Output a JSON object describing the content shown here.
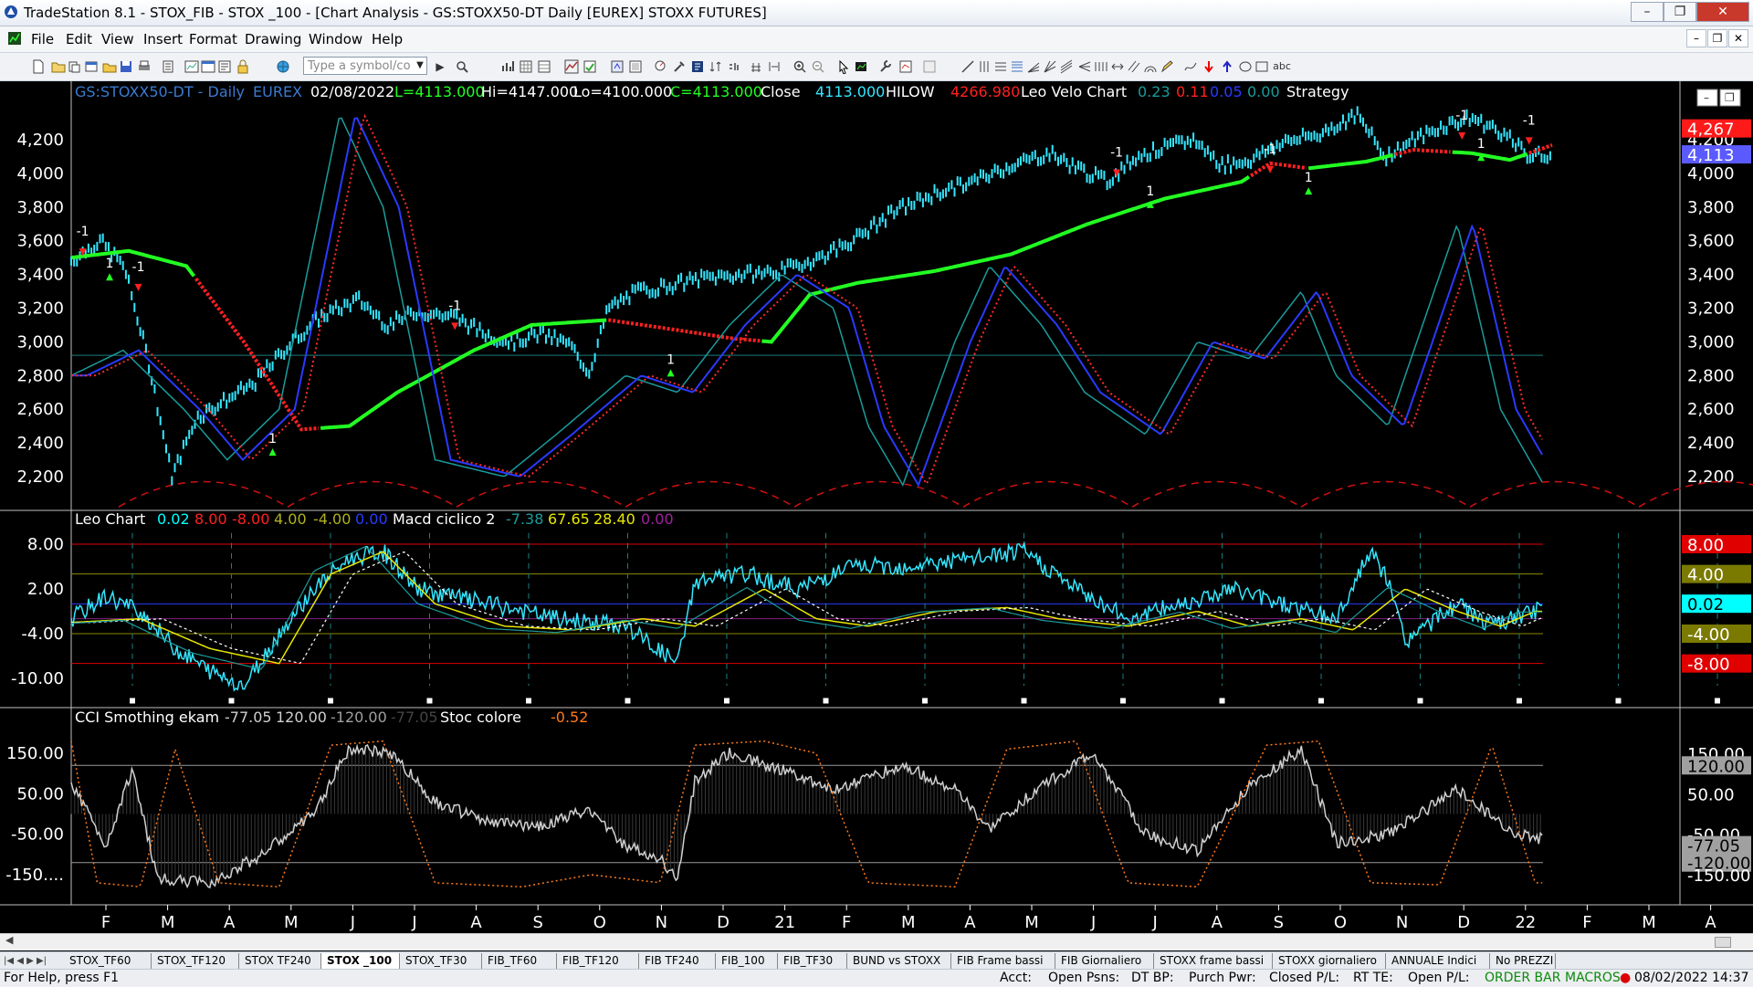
{
  "window": {
    "title": "TradeStation 8.1 - STOX_FIB - STOX _100 - [Chart Analysis - GS:STOXX50-DT  Daily  [EUREX] STOXX FUTURES]",
    "controls": [
      "–",
      "❐",
      "✕"
    ]
  },
  "menu": {
    "items": [
      "File",
      "Edit",
      "View",
      "Insert",
      "Format",
      "Drawing",
      "Window",
      "Help"
    ],
    "mdi_controls": [
      "–",
      "❐",
      "✕"
    ]
  },
  "toolbar": {
    "symbol_placeholder": "Type a symbol/co",
    "text_tool": "abc"
  },
  "price_panel": {
    "header": {
      "symbol": "GS:STOXX50-DT - Daily",
      "exchange": "EUREX",
      "date": "02/08/2022",
      "last": "L=4113.000",
      "high": "Hi=4147.000",
      "low": "Lo=4100.000",
      "close_eq": "C=4113.000",
      "close_label": "Close",
      "close_value": "4113.000",
      "hilow_label": "HILOW",
      "hilow_value": "4266.980",
      "study_name": "Leo Velo Chart",
      "v1": "0.23",
      "v2": "0.11",
      "v3": "0.05",
      "v4": "0.00",
      "strategy": "Strategy"
    },
    "y_labels": [
      "4,200",
      "4,000",
      "3,800",
      "3,600",
      "3,400",
      "3,200",
      "3,000",
      "2,800",
      "2,600",
      "2,400",
      "2,200"
    ],
    "y_values": [
      4200,
      4000,
      3800,
      3600,
      3400,
      3200,
      3000,
      2800,
      2600,
      2400,
      2200
    ],
    "right_markers": [
      {
        "text": "4,267",
        "value": 4267,
        "color": "#ff1a1a"
      },
      {
        "text": "4,113",
        "value": 4113,
        "color": "#5a5aff"
      }
    ],
    "trade_marks": [
      {
        "text": "-1",
        "value": 3630
      },
      {
        "text": "1",
        "value": 3440
      },
      {
        "text": "-1",
        "value": 3420
      },
      {
        "text": "1",
        "value": 2400
      },
      {
        "text": "-1",
        "value": 3190
      },
      {
        "text": "1",
        "value": 2870
      },
      {
        "text": "-1",
        "value": 4100
      },
      {
        "text": "1",
        "value": 3870
      },
      {
        "text": "-1",
        "value": 4120
      },
      {
        "text": "1",
        "value": 3950
      },
      {
        "text": "-1",
        "value": 4320
      },
      {
        "text": "1",
        "value": 4150
      },
      {
        "text": "-1",
        "value": 4290
      }
    ]
  },
  "macd_panel": {
    "header": {
      "study1": "Leo Chart",
      "a": "0.02",
      "b": "8.00",
      "c": "-8.00",
      "d": "4.00",
      "e": "-4.00",
      "f": "0.00",
      "study2": "Macd ciclico 2",
      "g": "-7.38",
      "h": "67.65",
      "i": "28.40",
      "j": "0.00"
    },
    "y_labels": [
      "8.00",
      "2.00",
      "-4.00",
      "-10.00"
    ],
    "y_values": [
      8,
      2,
      -4,
      -10
    ],
    "right_markers": [
      {
        "text": "8.00",
        "value": 8,
        "color": "#e00000",
        "fg": "#ffffff"
      },
      {
        "text": "4.00",
        "value": 4,
        "color": "#7a7a00",
        "fg": "#ffffff"
      },
      {
        "text": "0.02",
        "value": 0.02,
        "color": "#00ffff",
        "fg": "#000000"
      },
      {
        "text": "-4.00",
        "value": -4,
        "color": "#7a7a00",
        "fg": "#ffffff"
      },
      {
        "text": "-8.00",
        "value": -8,
        "color": "#e00000",
        "fg": "#ffffff"
      }
    ]
  },
  "cci_panel": {
    "header": {
      "study1": "CCI Smothing ekam",
      "a": "-77.05",
      "b": "120.00",
      "c": "-120.00",
      "d": "-77.05",
      "study2": "Stoc colore",
      "e": "-0.52"
    },
    "y_labels": [
      "150.00",
      "50.00",
      "-50.00",
      "-150...."
    ],
    "y_values": [
      150,
      50,
      -50,
      -150
    ],
    "right_labels": [
      {
        "text": "150.00",
        "value": 150
      },
      {
        "text": "120.00",
        "value": 120,
        "box": true
      },
      {
        "text": "50.00",
        "value": 50
      },
      {
        "text": "-50.00",
        "value": -50
      },
      {
        "text": "-77.05",
        "value": -77.05,
        "box": true
      },
      {
        "text": "-120.00",
        "value": -120,
        "box": true
      },
      {
        "text": "-150.00",
        "value": -150
      }
    ]
  },
  "x_axis": {
    "labels": [
      "F",
      "M",
      "A",
      "M",
      "J",
      "J",
      "A",
      "S",
      "O",
      "N",
      "D",
      "21",
      "F",
      "M",
      "A",
      "M",
      "J",
      "J",
      "A",
      "S",
      "O",
      "N",
      "D",
      "22",
      "F",
      "M",
      "A"
    ]
  },
  "workspace_tabs": [
    "STOX_TF60",
    "STOX_TF120",
    "STOX TF240",
    "STOX _100",
    "STOX_TF30",
    "FIB_TF60",
    "FIB_TF120",
    "FIB TF240",
    "FIB_100",
    "FIB_TF30",
    "BUND vs STOXX",
    "FIB Frame bassi",
    "FIB Giornaliero",
    "STOXX frame bassi",
    "STOXX giornaliero",
    "ANNUALE Indici",
    "No PREZZI"
  ],
  "active_tab": "STOX _100",
  "status_bar": {
    "help": "For Help, press F1",
    "acct": "Acct:",
    "open_psns": "Open Psns:",
    "dt_bp": "DT BP:",
    "purch_pwr": "Purch Pwr:",
    "closed_pl": "Closed P/L:",
    "rt_te": "RT TE:",
    "open_pl": "Open P/L:",
    "order_bar": "ORDER BAR",
    "macros": "MACROS",
    "datetime": "08/02/2022 14:37"
  },
  "colors": {
    "price_bars": "#33e6ff",
    "trend_up": "#22ff22",
    "trend_down": "#ff2020",
    "osc_blue": "#2a3aff",
    "osc_red_dotted": "#ff2a2a",
    "osc_teal": "#1a9c9c",
    "macd_yellow": "#e8e800",
    "cci_white": "#d0d0d0",
    "stoc_orange": "#ff7a1a"
  }
}
